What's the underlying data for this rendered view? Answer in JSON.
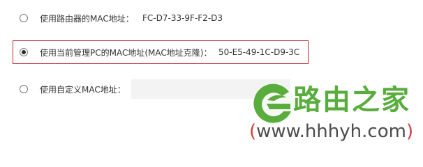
{
  "mac_clone": {
    "options": [
      {
        "label": "使用路由器的MAC地址：",
        "value": "FC-D7-33-9F-F2-D3",
        "selected": false
      },
      {
        "label": "使用当前管理PC的MAC地址(MAC地址克隆)：",
        "value": "50-E5-49-1C-D9-3C",
        "selected": true
      },
      {
        "label": "使用自定义MAC地址：",
        "input_value": "",
        "selected": false
      }
    ],
    "highlight_color": "#c0282d"
  },
  "watermark": {
    "brand": "路由之家",
    "url_open": "(",
    "url": "www.hhhyh.com",
    "url_close": ")",
    "colors": {
      "brand": "#58ad3c",
      "paren": "#d33b3b"
    }
  }
}
